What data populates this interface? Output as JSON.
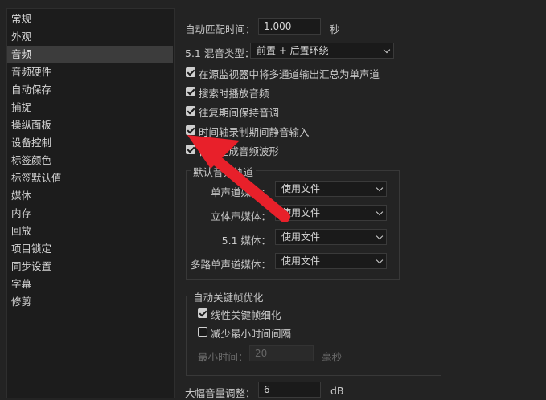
{
  "sidebar": {
    "items": [
      {
        "label": "常规"
      },
      {
        "label": "外观"
      },
      {
        "label": "音频"
      },
      {
        "label": "音频硬件"
      },
      {
        "label": "自动保存"
      },
      {
        "label": "捕捉"
      },
      {
        "label": "操纵面板"
      },
      {
        "label": "设备控制"
      },
      {
        "label": "标签颜色"
      },
      {
        "label": "标签默认值"
      },
      {
        "label": "媒体"
      },
      {
        "label": "内存"
      },
      {
        "label": "回放"
      },
      {
        "label": "项目锁定"
      },
      {
        "label": "同步设置"
      },
      {
        "label": "字幕"
      },
      {
        "label": "修剪"
      }
    ],
    "selected": "音频"
  },
  "audio": {
    "auto_match_label": "自动匹配时间：",
    "auto_match_value": "1.000",
    "auto_match_unit": "秒",
    "mix_label": "5.1 混音类型：",
    "mix_value": "前置 + 后置环绕",
    "checkboxes": [
      {
        "label": "在源监视器中将多通道输出汇总为单声道",
        "checked": true
      },
      {
        "label": "搜索时播放音频",
        "checked": true
      },
      {
        "label": "往复期间保持音调",
        "checked": true
      },
      {
        "label": "时间轴录制期间静音输入",
        "checked": true
      },
      {
        "label": "自动生成音频波形",
        "checked": true
      }
    ],
    "default_tracks": {
      "title": "默认音频轨道",
      "rows": [
        {
          "label": "单声道媒体：",
          "value": "使用文件"
        },
        {
          "label": "立体声媒体：",
          "value": "使用文件"
        },
        {
          "label": "5.1 媒体：",
          "value": "使用文件"
        },
        {
          "label": "多路单声道媒体：",
          "value": "使用文件"
        }
      ]
    },
    "keyframe": {
      "title": "自动关键帧优化",
      "linear_label": "线性关键帧细化",
      "linear_checked": true,
      "reduce_label": "减少最小时间间隔",
      "reduce_checked": false,
      "min_time_label": "最小时间：",
      "min_time_value": "20",
      "min_time_unit": "毫秒"
    },
    "volume_label": "大幅音量调整：",
    "volume_value": "6",
    "volume_unit": "dB"
  },
  "colors": {
    "annotation_arrow": "#e8202a",
    "selected_bg": "#3c3c3c"
  }
}
